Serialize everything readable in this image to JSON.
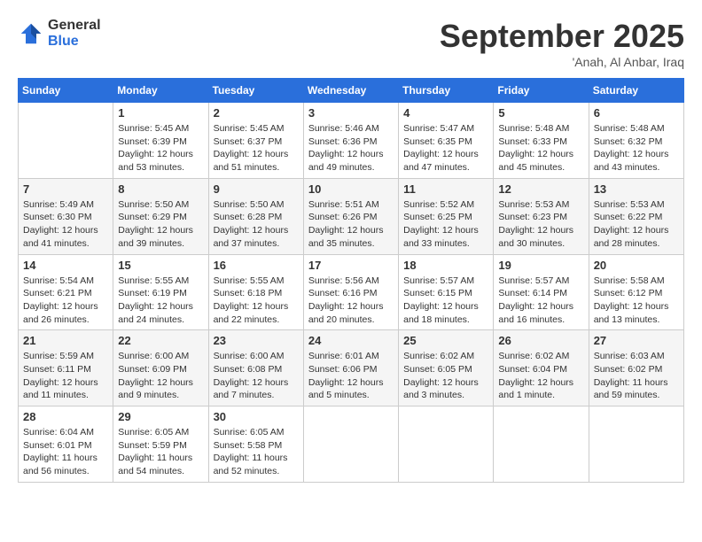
{
  "header": {
    "logo": {
      "general": "General",
      "blue": "Blue"
    },
    "title": "September 2025",
    "location": "'Anah, Al Anbar, Iraq"
  },
  "days": [
    "Sunday",
    "Monday",
    "Tuesday",
    "Wednesday",
    "Thursday",
    "Friday",
    "Saturday"
  ],
  "weeks": [
    [
      {
        "day": "",
        "info": ""
      },
      {
        "day": "1",
        "info": "Sunrise: 5:45 AM\nSunset: 6:39 PM\nDaylight: 12 hours\nand 53 minutes."
      },
      {
        "day": "2",
        "info": "Sunrise: 5:45 AM\nSunset: 6:37 PM\nDaylight: 12 hours\nand 51 minutes."
      },
      {
        "day": "3",
        "info": "Sunrise: 5:46 AM\nSunset: 6:36 PM\nDaylight: 12 hours\nand 49 minutes."
      },
      {
        "day": "4",
        "info": "Sunrise: 5:47 AM\nSunset: 6:35 PM\nDaylight: 12 hours\nand 47 minutes."
      },
      {
        "day": "5",
        "info": "Sunrise: 5:48 AM\nSunset: 6:33 PM\nDaylight: 12 hours\nand 45 minutes."
      },
      {
        "day": "6",
        "info": "Sunrise: 5:48 AM\nSunset: 6:32 PM\nDaylight: 12 hours\nand 43 minutes."
      }
    ],
    [
      {
        "day": "7",
        "info": "Sunrise: 5:49 AM\nSunset: 6:30 PM\nDaylight: 12 hours\nand 41 minutes."
      },
      {
        "day": "8",
        "info": "Sunrise: 5:50 AM\nSunset: 6:29 PM\nDaylight: 12 hours\nand 39 minutes."
      },
      {
        "day": "9",
        "info": "Sunrise: 5:50 AM\nSunset: 6:28 PM\nDaylight: 12 hours\nand 37 minutes."
      },
      {
        "day": "10",
        "info": "Sunrise: 5:51 AM\nSunset: 6:26 PM\nDaylight: 12 hours\nand 35 minutes."
      },
      {
        "day": "11",
        "info": "Sunrise: 5:52 AM\nSunset: 6:25 PM\nDaylight: 12 hours\nand 33 minutes."
      },
      {
        "day": "12",
        "info": "Sunrise: 5:53 AM\nSunset: 6:23 PM\nDaylight: 12 hours\nand 30 minutes."
      },
      {
        "day": "13",
        "info": "Sunrise: 5:53 AM\nSunset: 6:22 PM\nDaylight: 12 hours\nand 28 minutes."
      }
    ],
    [
      {
        "day": "14",
        "info": "Sunrise: 5:54 AM\nSunset: 6:21 PM\nDaylight: 12 hours\nand 26 minutes."
      },
      {
        "day": "15",
        "info": "Sunrise: 5:55 AM\nSunset: 6:19 PM\nDaylight: 12 hours\nand 24 minutes."
      },
      {
        "day": "16",
        "info": "Sunrise: 5:55 AM\nSunset: 6:18 PM\nDaylight: 12 hours\nand 22 minutes."
      },
      {
        "day": "17",
        "info": "Sunrise: 5:56 AM\nSunset: 6:16 PM\nDaylight: 12 hours\nand 20 minutes."
      },
      {
        "day": "18",
        "info": "Sunrise: 5:57 AM\nSunset: 6:15 PM\nDaylight: 12 hours\nand 18 minutes."
      },
      {
        "day": "19",
        "info": "Sunrise: 5:57 AM\nSunset: 6:14 PM\nDaylight: 12 hours\nand 16 minutes."
      },
      {
        "day": "20",
        "info": "Sunrise: 5:58 AM\nSunset: 6:12 PM\nDaylight: 12 hours\nand 13 minutes."
      }
    ],
    [
      {
        "day": "21",
        "info": "Sunrise: 5:59 AM\nSunset: 6:11 PM\nDaylight: 12 hours\nand 11 minutes."
      },
      {
        "day": "22",
        "info": "Sunrise: 6:00 AM\nSunset: 6:09 PM\nDaylight: 12 hours\nand 9 minutes."
      },
      {
        "day": "23",
        "info": "Sunrise: 6:00 AM\nSunset: 6:08 PM\nDaylight: 12 hours\nand 7 minutes."
      },
      {
        "day": "24",
        "info": "Sunrise: 6:01 AM\nSunset: 6:06 PM\nDaylight: 12 hours\nand 5 minutes."
      },
      {
        "day": "25",
        "info": "Sunrise: 6:02 AM\nSunset: 6:05 PM\nDaylight: 12 hours\nand 3 minutes."
      },
      {
        "day": "26",
        "info": "Sunrise: 6:02 AM\nSunset: 6:04 PM\nDaylight: 12 hours\nand 1 minute."
      },
      {
        "day": "27",
        "info": "Sunrise: 6:03 AM\nSunset: 6:02 PM\nDaylight: 11 hours\nand 59 minutes."
      }
    ],
    [
      {
        "day": "28",
        "info": "Sunrise: 6:04 AM\nSunset: 6:01 PM\nDaylight: 11 hours\nand 56 minutes."
      },
      {
        "day": "29",
        "info": "Sunrise: 6:05 AM\nSunset: 5:59 PM\nDaylight: 11 hours\nand 54 minutes."
      },
      {
        "day": "30",
        "info": "Sunrise: 6:05 AM\nSunset: 5:58 PM\nDaylight: 11 hours\nand 52 minutes."
      },
      {
        "day": "",
        "info": ""
      },
      {
        "day": "",
        "info": ""
      },
      {
        "day": "",
        "info": ""
      },
      {
        "day": "",
        "info": ""
      }
    ]
  ]
}
